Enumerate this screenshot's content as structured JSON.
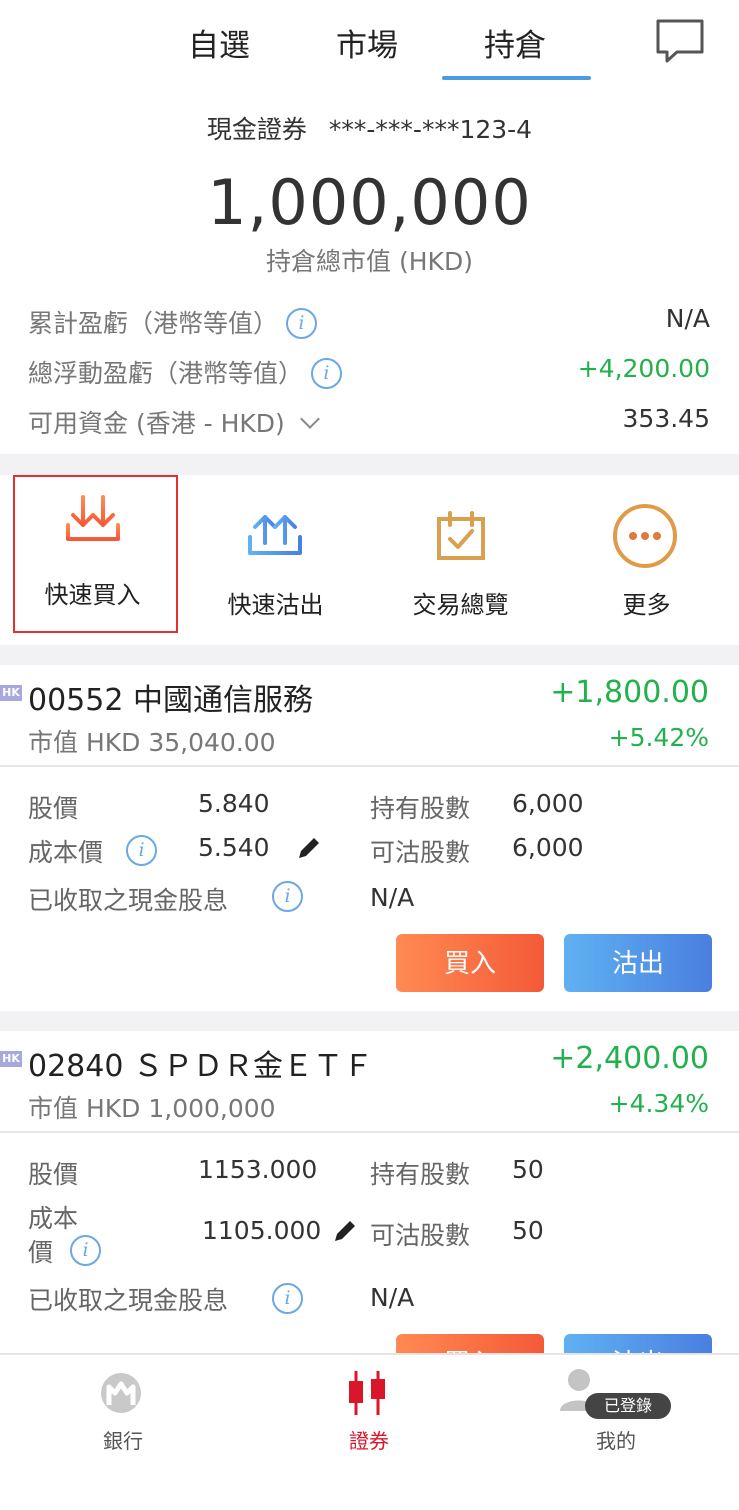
{
  "top_tabs": [
    "自選",
    "市場",
    "持倉"
  ],
  "active_tab": "持倉",
  "summary": {
    "account_type": "現金證券",
    "account_number": "***-***-***123-4",
    "total_value": "1,000,000",
    "total_label": "持倉總市值 (HKD)",
    "rows": [
      {
        "label": "累計盈虧（港幣等值）",
        "value": "N/A"
      },
      {
        "label": "總浮動盈虧（港幣等值）",
        "value": "+4,200.00"
      },
      {
        "label": "可用資金 (香港 - HKD)",
        "value": "353.45"
      }
    ]
  },
  "actions": [
    {
      "label": "快速買入",
      "icon": "download-tray-icon"
    },
    {
      "label": "快速沽出",
      "icon": "upload-tray-icon"
    },
    {
      "label": "交易總覽",
      "icon": "calendar-check-icon"
    },
    {
      "label": "更多",
      "icon": "more-dots-icon"
    }
  ],
  "stocks": [
    {
      "market_badge": "HK",
      "name": "00552 中國通信服務",
      "gain": "+1,800.00",
      "market_value": "市值 HKD 35,040.00",
      "gain_pct": "+5.42%",
      "price_label": "股價",
      "price": "5.840",
      "held_label": "持有股數",
      "held": "6,000",
      "cost_label": "成本價",
      "cost": "5.540",
      "sellable_label": "可沽股數",
      "sellable": "6,000",
      "dividend_label": "已收取之現金股息",
      "dividend": "N/A",
      "buy_label": "買入",
      "sell_label": "沽出"
    },
    {
      "market_badge": "HK",
      "name": "02840 ＳＰＤＲ金ＥＴＦ",
      "gain": "+2,400.00",
      "market_value": "市值 HKD 1,000,000",
      "gain_pct": "+4.34%",
      "price_label": "股價",
      "price": "1153.000",
      "held_label": "持有股數",
      "held": "50",
      "cost_label_1": "成本",
      "cost_label_2": "價",
      "cost": "1105.000",
      "sellable_label": "可沽股數",
      "sellable": "50",
      "dividend_label": "已收取之現金股息",
      "dividend": "N/A",
      "buy_label": "買入",
      "sell_label": "沽出"
    }
  ],
  "bottom_nav": [
    {
      "label": "銀行",
      "icon": "bank-logo-icon"
    },
    {
      "label": "證券",
      "icon": "candlestick-icon"
    },
    {
      "label": "我的",
      "icon": "user-avatar-icon"
    }
  ],
  "login_badge": "已登錄",
  "colors": {
    "accent_blue": "#4a9be0",
    "gain_green": "#22b14c",
    "buy_orange": "#f45a38",
    "sell_blue": "#4a7fe0",
    "active_red": "#d9162a"
  }
}
